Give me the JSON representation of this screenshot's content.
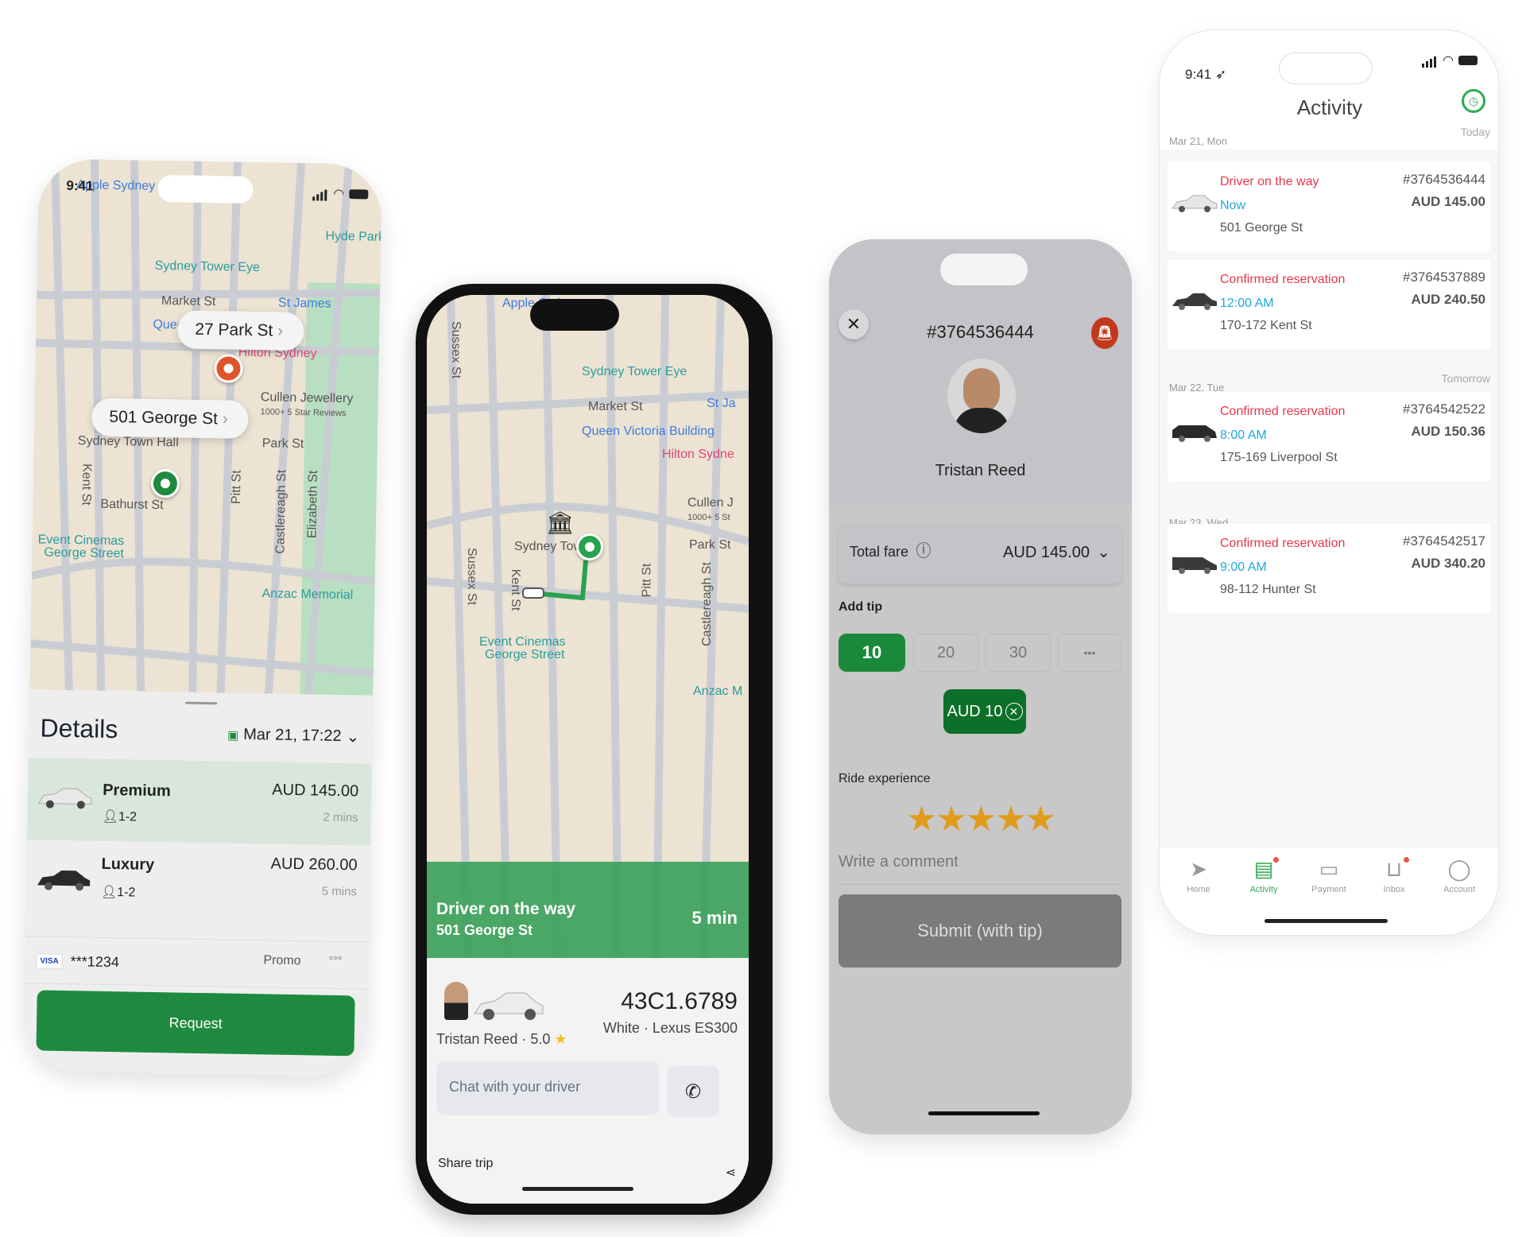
{
  "colors": {
    "brand_green": "#1e8a3f",
    "alert_red": "#e8364a",
    "time_blue": "#20a8d8",
    "star": "#e09b1c",
    "origin_pin": "#1e8a3f",
    "destination_pin": "#e0542c"
  },
  "status_time": "9:41",
  "booking": {
    "map_labels": [
      "Apple Sydney",
      "Hyde Park",
      "Sydney Tower Eye",
      "Market St",
      "St James",
      "Queen",
      "Hilton Sydney",
      "Cullen Jewellery",
      "1000+ 5 Star Reviews",
      "Park St",
      "Sydney Town Hall",
      "Kent St",
      "Pitt St",
      "Castlereagh St",
      "Elizabeth St",
      "Bathurst St",
      "Event Cinemas",
      "George Street",
      "Anzac Memorial",
      "St James",
      "Hyd"
    ],
    "destination_pill": "27 Park St",
    "origin_pill": "501 George St",
    "details_title": "Details",
    "date_label": "Mar 21, 17:22",
    "options": [
      {
        "name": "Premium",
        "seats": "1-2",
        "price": "AUD 145.00",
        "eta": "2 mins",
        "selected": true
      },
      {
        "name": "Luxury",
        "seats": "1-2",
        "price": "AUD 260.00",
        "eta": "5 mins",
        "selected": false
      }
    ],
    "card_brand": "VISA",
    "card_number": "***1234",
    "promo_label": "Promo",
    "more_label": "◦◦◦",
    "request_label": "Request"
  },
  "tracking": {
    "map_labels": [
      "Apple Sydney",
      "Sussex St",
      "Sydney Tower Eye",
      "Market St",
      "St Ja",
      "Queen Victoria Building",
      "Hilton Sydne",
      "Cullen J",
      "1000+ 5 St",
      "Sydney Town",
      "Park St",
      "Sussex St",
      "Kent St",
      "Pitt St",
      "Castlereagh St",
      "Event Cinemas",
      "George Street",
      "Anzac M"
    ],
    "banner_title": "Driver on the way",
    "banner_address": "501 George St",
    "eta": "5 min",
    "plate": "43C1.6789",
    "vehicle": "White · Lexus ES300",
    "driver": "Tristan Reed · 5.0",
    "chat_placeholder": "Chat with your driver",
    "share_label": "Share trip"
  },
  "rating": {
    "order_id": "#3764536444",
    "driver_name": "Tristan Reed",
    "total_fare_label": "Total fare",
    "total_fare": "AUD 145.00",
    "add_tip_label": "Add tip",
    "tip_options": [
      "10",
      "20",
      "30",
      "•••"
    ],
    "selected_tip": "10",
    "tip_chip": "AUD 10",
    "ride_experience_label": "Ride experience",
    "stars": 5,
    "comment_placeholder": "Write a comment",
    "submit_label": "Submit (with tip)"
  },
  "activity": {
    "title": "Activity",
    "groups": [
      {
        "date": "Mar 21, Mon",
        "relative": "Today",
        "items": [
          {
            "status": "Driver on the way",
            "time": "Now",
            "address": "501 George St",
            "id": "#3764536444",
            "price": "AUD 145.00",
            "car": "white-sedan"
          },
          {
            "status": "Confirmed reservation",
            "time": "12:00 AM",
            "address": "170-172 Kent St",
            "id": "#3764537889",
            "price": "AUD 240.50",
            "car": "dark-sedan"
          }
        ]
      },
      {
        "date": "Mar 22, Tue",
        "relative": "Tomorrow",
        "items": [
          {
            "status": "Confirmed reservation",
            "time": "8:00 AM",
            "address": "175-169 Liverpool St",
            "id": "#3764542522",
            "price": "AUD 150.36",
            "car": "black-minivan"
          }
        ]
      },
      {
        "date": "Mar 23, Wed",
        "relative": "",
        "items": [
          {
            "status": "Confirmed reservation",
            "time": "9:00 AM",
            "address": "98-112 Hunter St",
            "id": "#3764542517",
            "price": "AUD 340.20",
            "car": "van"
          }
        ]
      }
    ],
    "tabs": [
      {
        "label": "Home",
        "icon": "navigation-icon",
        "active": false,
        "badge": false
      },
      {
        "label": "Activity",
        "icon": "activity-list-icon",
        "active": true,
        "badge": true
      },
      {
        "label": "Payment",
        "icon": "wallet-icon",
        "active": false,
        "badge": false
      },
      {
        "label": "Inbox",
        "icon": "inbox-icon",
        "active": false,
        "badge": true
      },
      {
        "label": "Account",
        "icon": "account-icon",
        "active": false,
        "badge": false
      }
    ]
  }
}
